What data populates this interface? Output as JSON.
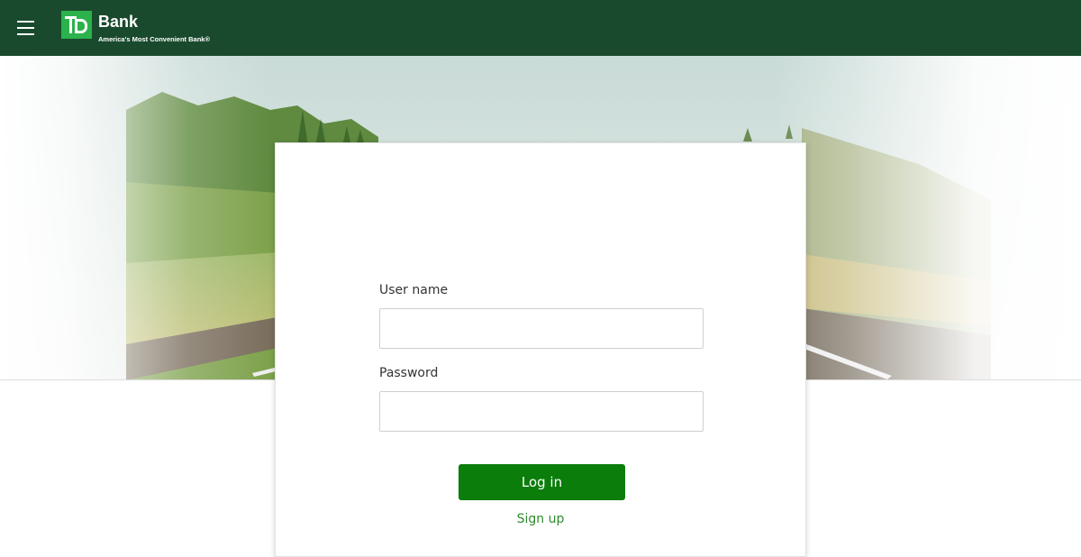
{
  "header": {
    "menu_icon": "hamburger-menu-icon",
    "logo": {
      "mark": "TD",
      "name": "Bank",
      "tagline": "America's Most Convenient Bank®"
    },
    "background_color": "#1a4a2e"
  },
  "hero": {
    "image": "forest-road-landscape"
  },
  "login": {
    "username_label": "User name",
    "username_value": "",
    "password_label": "Password",
    "password_value": "",
    "login_button": "Log in",
    "signup_link": "Sign up",
    "button_color": "#0a7d0a",
    "link_color": "#2e8b2e"
  }
}
